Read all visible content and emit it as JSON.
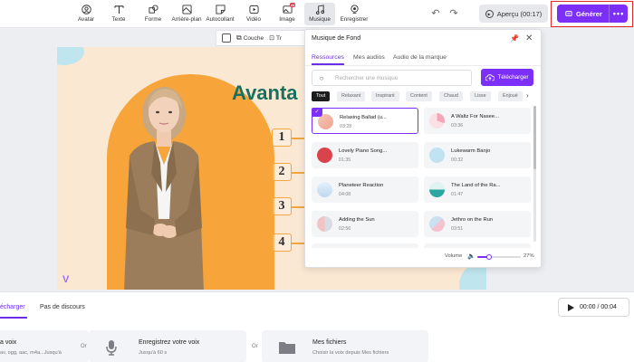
{
  "toolbar": {
    "items": [
      {
        "label": "Avatar",
        "icon": "avatar-icon"
      },
      {
        "label": "Texte",
        "icon": "text-icon"
      },
      {
        "label": "Forme",
        "icon": "shape-icon"
      },
      {
        "label": "Arrière-plan",
        "icon": "background-icon"
      },
      {
        "label": "Autocollant",
        "icon": "sticker-icon"
      },
      {
        "label": "Vidéo",
        "icon": "video-icon"
      },
      {
        "label": "Image",
        "icon": "image-icon",
        "badge": "AI"
      },
      {
        "label": "Musique",
        "icon": "music-icon"
      },
      {
        "label": "Enregistrer",
        "icon": "record-icon"
      }
    ],
    "undo_icon": "undo-icon",
    "redo_icon": "redo-icon",
    "preview_label": "Aperçu (00:17)",
    "generate_label": "Générer",
    "more_label": "•••"
  },
  "subbar": {
    "layer_label": "Couche",
    "truncated_label": "Tr"
  },
  "slide": {
    "title": "Avanta",
    "numbers": [
      "1",
      "2",
      "3",
      "4"
    ],
    "watermark": "V"
  },
  "music_panel": {
    "title": "Musique de Fond",
    "tabs": [
      "Ressources",
      "Mes audios",
      "Audio de la marque"
    ],
    "search_placeholder": "Rechercher une musique",
    "upload_label": "Télécharger",
    "chips": [
      "Tout",
      "Relaxant",
      "Inspirant",
      "Content",
      "Chaud",
      "Lisse",
      "Enjoué"
    ],
    "tracks": [
      {
        "name": "Relaxing Ballad (u...",
        "duration": "03:28",
        "selected": true
      },
      {
        "name": "A Waltz For Nasee...",
        "duration": "03:36",
        "selected": false
      },
      {
        "name": "Lovely Piano Song...",
        "duration": "01:35",
        "selected": false
      },
      {
        "name": "Lukewarm Banjo",
        "duration": "00:32",
        "selected": false
      },
      {
        "name": "Planeteer Reaction",
        "duration": "04:08",
        "selected": false
      },
      {
        "name": "The Land of the Ra...",
        "duration": "01:47",
        "selected": false
      },
      {
        "name": "Adding the Sun",
        "duration": "02:56",
        "selected": false
      },
      {
        "name": "Jethro on the Run",
        "duration": "03:51",
        "selected": false
      }
    ],
    "volume_label": "Volume",
    "volume_percent": "27%",
    "volume_value": 0.27
  },
  "bottom": {
    "tabs": [
      "écharger",
      "Pas de discours"
    ],
    "timer": "00:00 / 00:04",
    "cards": [
      {
        "title": "a voix",
        "subtitle": "av, ogg, aac, m4a...Jusqu'à"
      },
      {
        "title": "Enregistrez votre voix",
        "subtitle": "Jusqu'à 60 s"
      },
      {
        "title": "Mes fichiers",
        "subtitle": "Choisir la voix depuis Mes fichiers"
      }
    ],
    "or_label": "Or"
  },
  "colors": {
    "accent": "#7b2ff7",
    "highlight_border": "#e02a2a",
    "slide_bg": "#fbe8d3",
    "slide_orange": "#f7a53a",
    "slide_title": "#18705e"
  }
}
